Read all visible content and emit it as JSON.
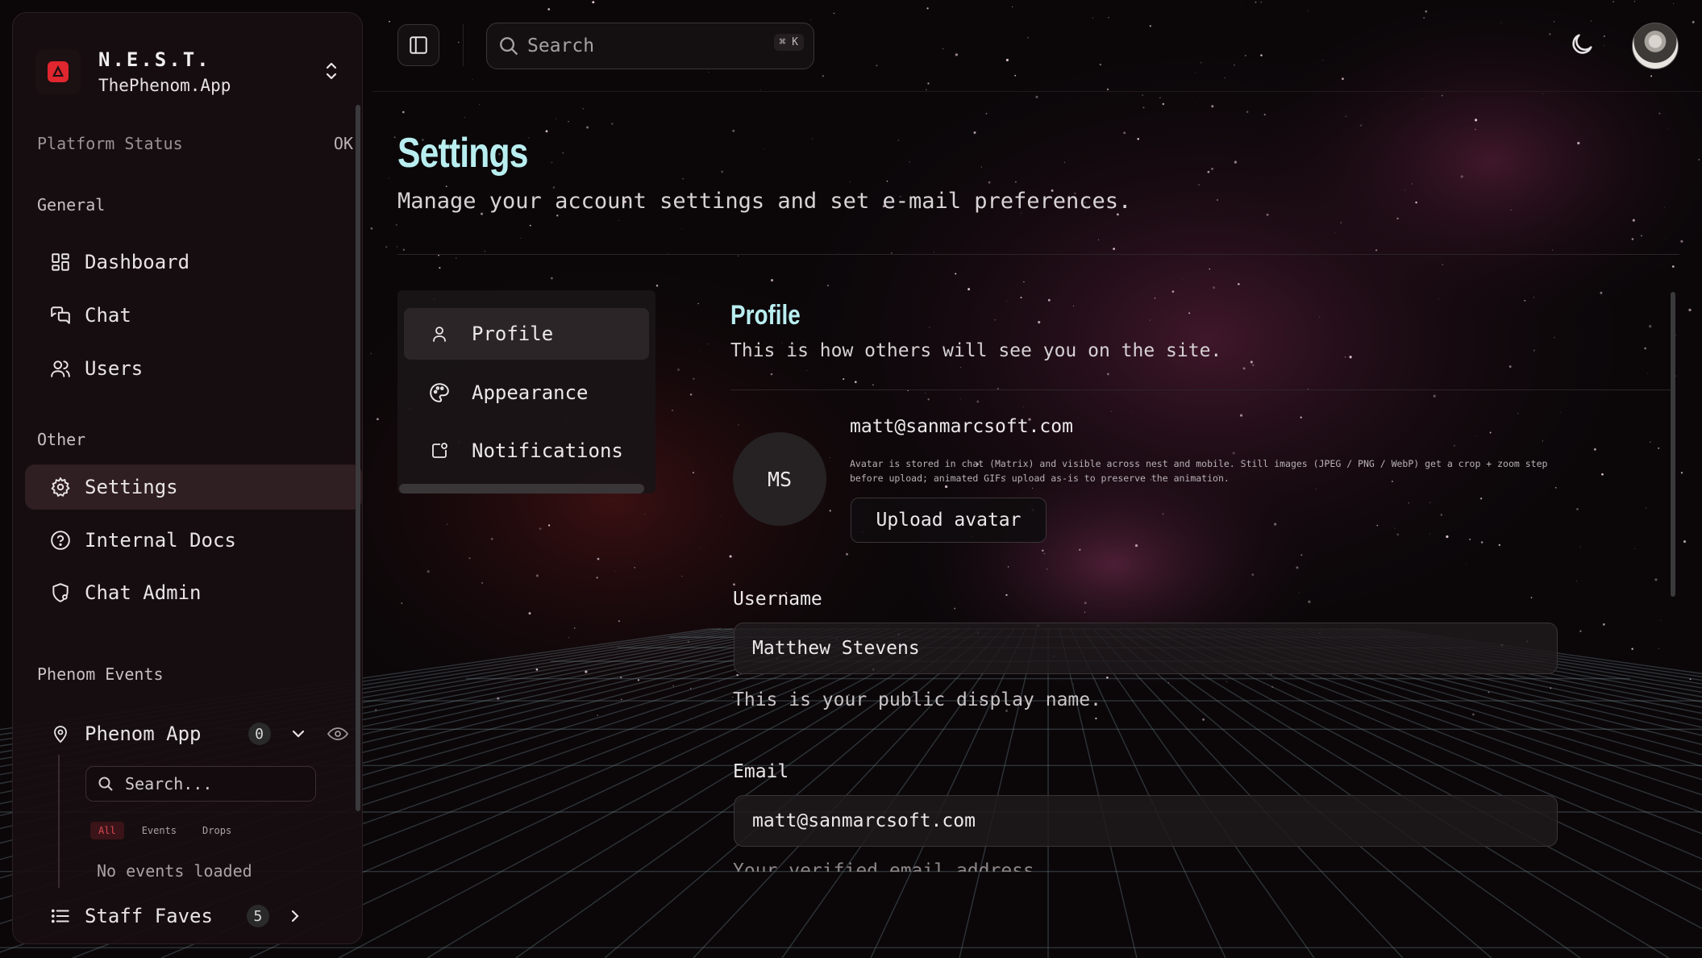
{
  "brand": {
    "name": "N.E.S.T.",
    "subtitle": "ThePhenom.App"
  },
  "platform_status": {
    "label": "Platform Status",
    "value": "OK"
  },
  "sidebar": {
    "general_label": "General",
    "general_items": [
      {
        "label": "Dashboard",
        "icon": "dashboard-icon"
      },
      {
        "label": "Chat",
        "icon": "chat-icon"
      },
      {
        "label": "Users",
        "icon": "users-icon"
      }
    ],
    "other_label": "Other",
    "other_items": [
      {
        "label": "Settings",
        "icon": "gear-icon",
        "active": true
      },
      {
        "label": "Internal Docs",
        "icon": "help-circle-icon"
      },
      {
        "label": "Chat Admin",
        "icon": "shield-gear-icon"
      }
    ],
    "events_label": "Phenom Events",
    "events_group": {
      "label": "Phenom App",
      "count": "0",
      "icon": "map-pin-icon"
    },
    "events_search_placeholder": "Search...",
    "filters": [
      "All",
      "Events",
      "Drops"
    ],
    "active_filter": "All",
    "no_events": "No events loaded",
    "staff_faves": {
      "label": "Staff Faves",
      "count": "5"
    }
  },
  "topbar": {
    "search_placeholder": "Search",
    "shortcut": "⌘ K",
    "theme_icon": "moon-icon"
  },
  "page": {
    "title": "Settings",
    "subtitle": "Manage your account settings and set e-mail preferences."
  },
  "settings_nav": [
    {
      "label": "Profile",
      "icon": "user-icon",
      "active": true
    },
    {
      "label": "Appearance",
      "icon": "palette-icon"
    },
    {
      "label": "Notifications",
      "icon": "notification-icon"
    }
  ],
  "profile": {
    "title": "Profile",
    "subtitle": "This is how others will see you on the site.",
    "avatar_initials": "MS",
    "email_display": "matt@sanmarcsoft.com",
    "avatar_note": "Avatar is stored in chat (Matrix) and visible across nest and mobile. Still images (JPEG / PNG / WebP) get a crop + zoom step before upload; animated GIFs upload as-is to preserve the animation.",
    "upload_label": "Upload avatar",
    "username_label": "Username",
    "username_value": "Matthew Stevens",
    "username_hint": "This is your public display name.",
    "email_label": "Email",
    "email_value": "matt@sanmarcsoft.com",
    "email_hint": "Your verified email address."
  },
  "colors": {
    "accent_title": "#b9eef0",
    "active_filter": "#d94850",
    "brand_red": "#e0262e"
  }
}
